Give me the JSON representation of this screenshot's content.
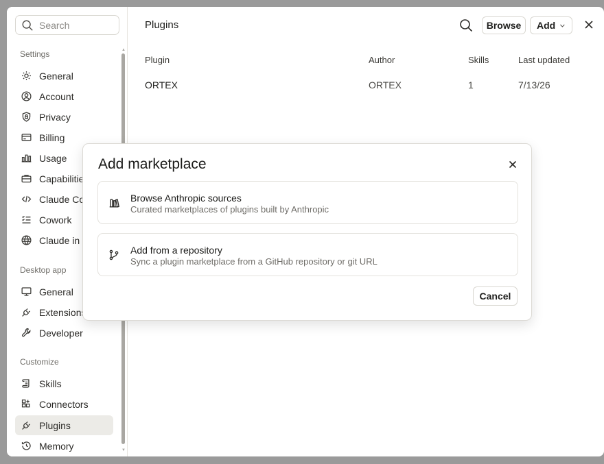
{
  "sidebar": {
    "search_placeholder": "Search",
    "sections": [
      {
        "label": "Settings"
      },
      {
        "label": "Desktop app"
      },
      {
        "label": "Customize"
      }
    ],
    "items": [
      {
        "label": "General",
        "icon": "gear-icon"
      },
      {
        "label": "Account",
        "icon": "user-circle-icon"
      },
      {
        "label": "Privacy",
        "icon": "shield-icon"
      },
      {
        "label": "Billing",
        "icon": "credit-card-icon"
      },
      {
        "label": "Usage",
        "icon": "bar-chart-icon"
      },
      {
        "label": "Capabilities",
        "icon": "briefcase-icon"
      },
      {
        "label": "Claude Code",
        "icon": "code-icon"
      },
      {
        "label": "Cowork",
        "icon": "checklist-icon"
      },
      {
        "label": "Claude in Chrome",
        "icon": "globe-icon"
      },
      {
        "label": "General",
        "icon": "monitor-icon"
      },
      {
        "label": "Extensions",
        "icon": "plug-icon"
      },
      {
        "label": "Developer",
        "icon": "wrench-icon"
      },
      {
        "label": "Skills",
        "icon": "scroll-icon"
      },
      {
        "label": "Connectors",
        "icon": "grid-plus-icon"
      },
      {
        "label": "Plugins",
        "icon": "plug-icon",
        "active": true
      },
      {
        "label": "Memory",
        "icon": "history-icon"
      }
    ]
  },
  "main": {
    "title": "Plugins",
    "browse_label": "Browse",
    "add_label": "Add",
    "table": {
      "headers": [
        "Plugin",
        "Author",
        "Skills",
        "Last updated"
      ],
      "rows": [
        [
          "ORTEX",
          "ORTEX",
          "1",
          "7/13/26"
        ]
      ]
    }
  },
  "modal": {
    "title": "Add marketplace",
    "options": [
      {
        "title": "Browse Anthropic sources",
        "description": "Curated marketplaces of plugins built by Anthropic",
        "icon": "library-icon"
      },
      {
        "title": "Add from a repository",
        "description": "Sync a plugin marketplace from a GitHub repository or git URL",
        "icon": "git-branch-icon"
      }
    ],
    "cancel_label": "Cancel"
  }
}
